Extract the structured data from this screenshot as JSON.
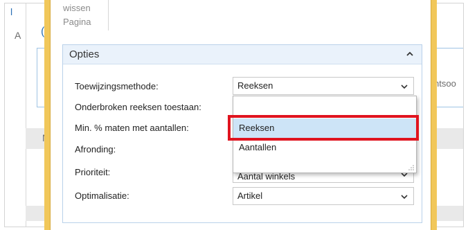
{
  "background": {
    "left_fragment_1": "l",
    "left_fragment_2": "A",
    "link_fragment": "(",
    "right_fragment": "ntsoo",
    "left_fragment_3": "N"
  },
  "top_tab": {
    "line1": "wissen",
    "line2": "Pagina"
  },
  "options_section": {
    "title": "Opties",
    "fields": [
      {
        "label": "Toewijzingsmethode:",
        "value": "Reeksen"
      },
      {
        "label": "Onderbroken reeksen toestaan:"
      },
      {
        "label": "Min. % maten met aantallen:"
      },
      {
        "label": "Afronding:"
      },
      {
        "label": "Prioriteit:",
        "value": "Aantal winkels"
      },
      {
        "label": "Optimalisatie:",
        "value": "Artikel"
      }
    ]
  },
  "dropdown": {
    "options": [
      "Reeksen",
      "Aantallen"
    ],
    "selected": "Reeksen"
  },
  "colors": {
    "highlight": "#e0141f",
    "selected_option": "#cde4f7",
    "dialog_edge": "#f1c75a"
  }
}
